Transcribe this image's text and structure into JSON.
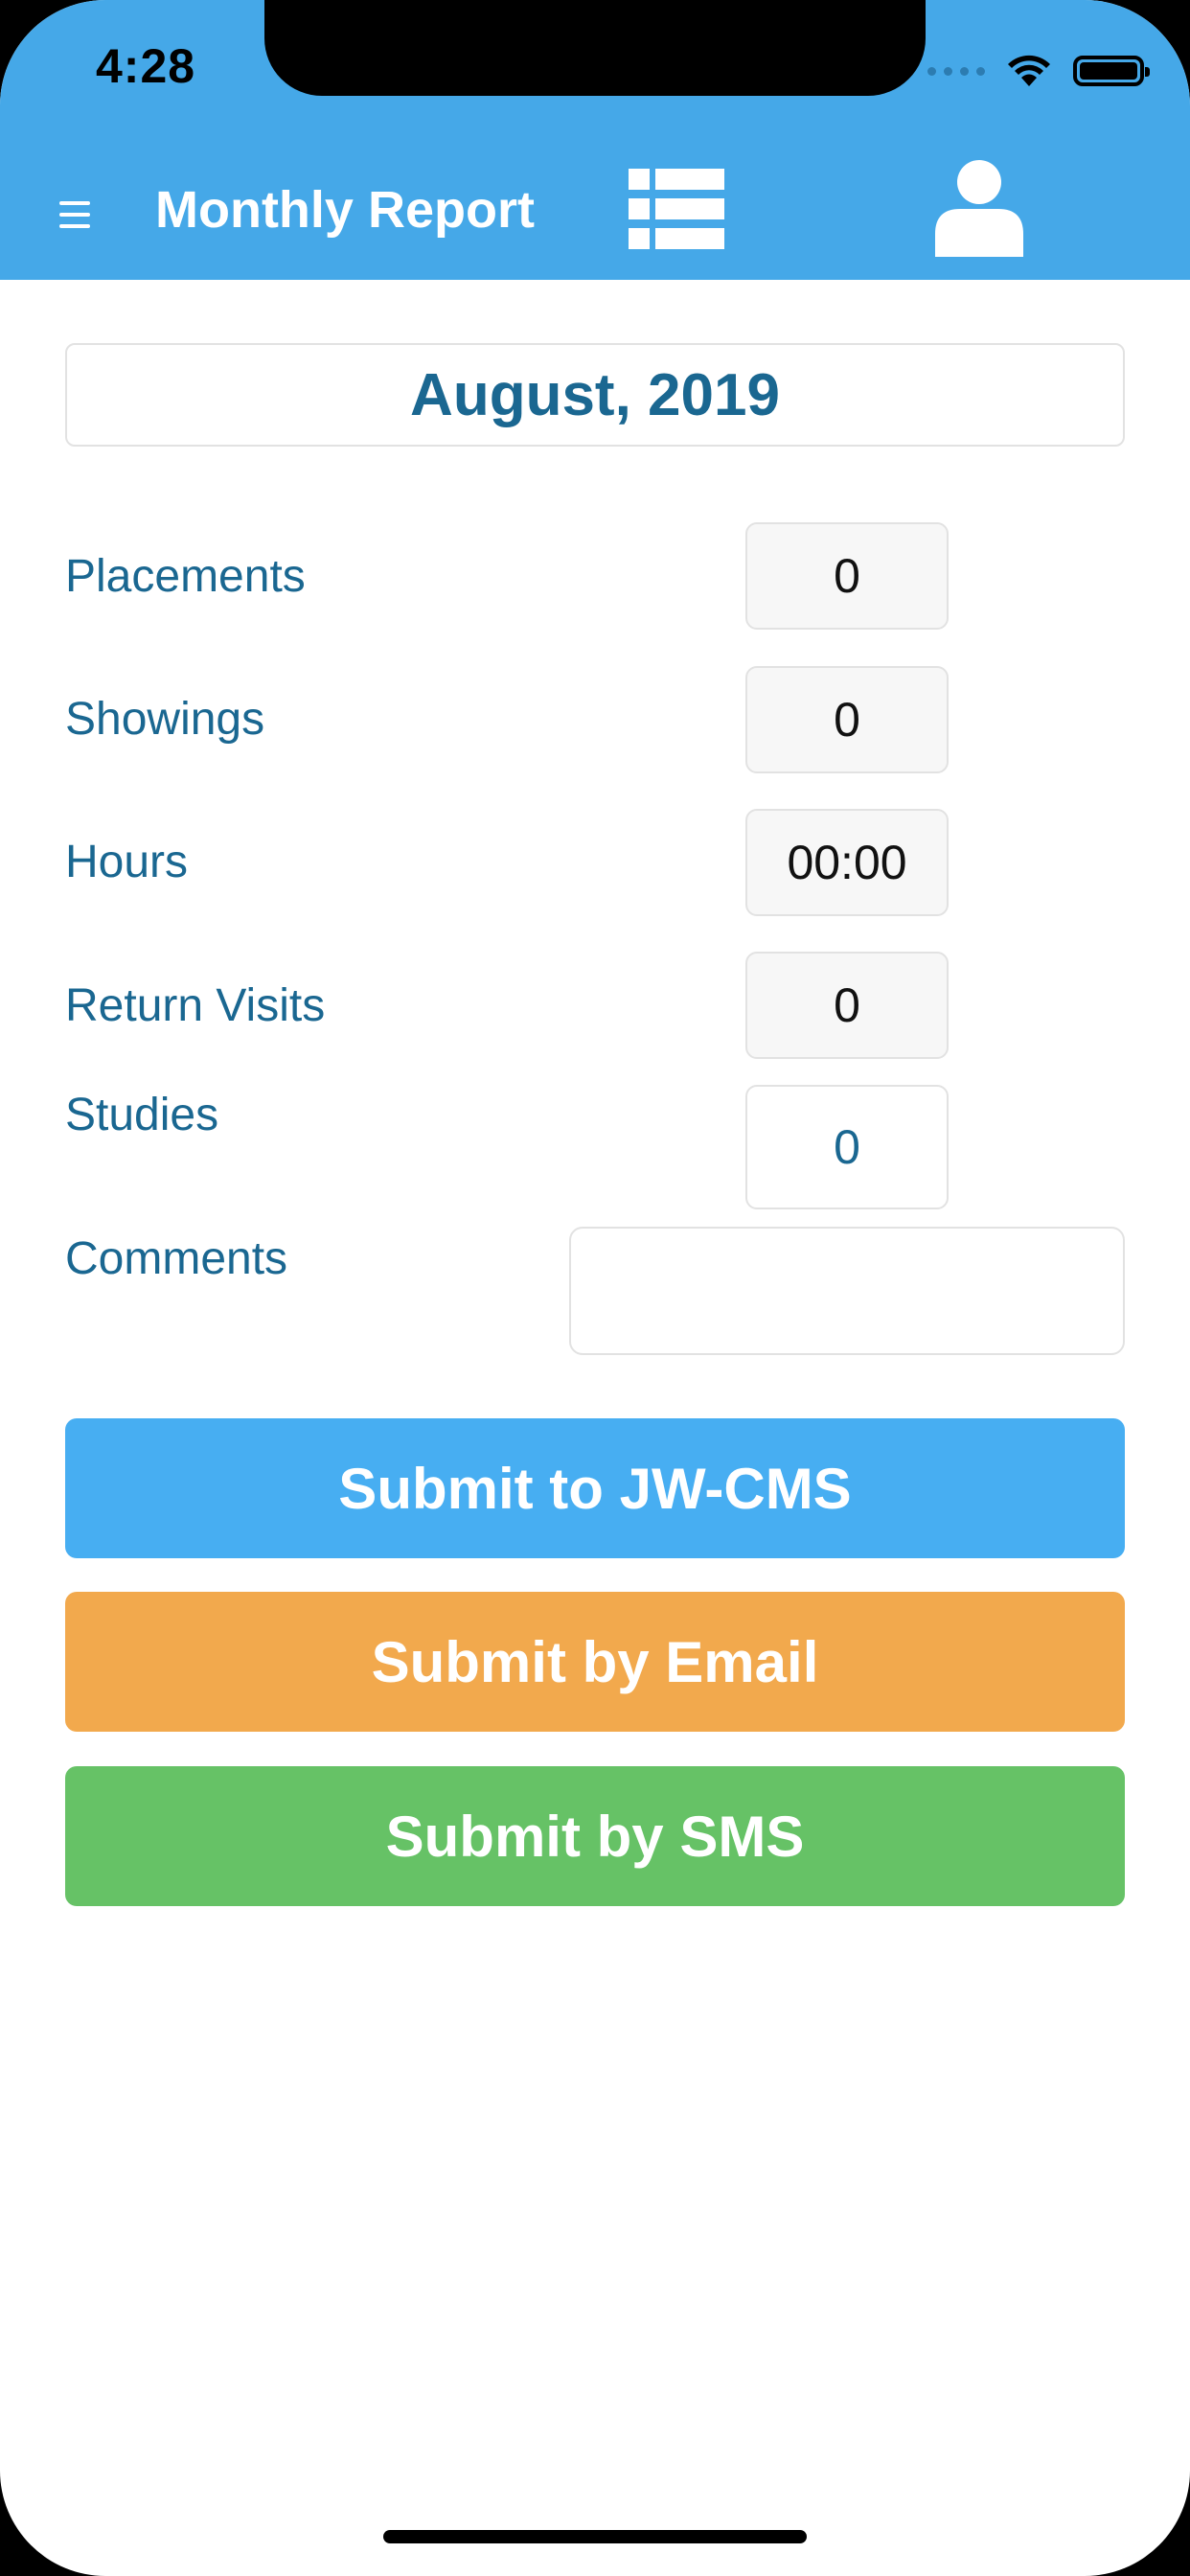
{
  "status_bar": {
    "time": "4:28",
    "wifi_icon": "wifi-icon",
    "battery_icon": "battery-icon"
  },
  "nav": {
    "menu_icon": "hamburger-menu-icon",
    "title": "Monthly Report",
    "list_icon": "list-view-icon",
    "profile_icon": "user-profile-icon"
  },
  "report": {
    "month": "August, 2019",
    "fields": [
      {
        "label": "Placements",
        "value": "0"
      },
      {
        "label": "Showings",
        "value": "0"
      },
      {
        "label": "Hours",
        "value": "00:00"
      },
      {
        "label": "Return Visits",
        "value": "0"
      },
      {
        "label": "Studies",
        "value": "0"
      }
    ],
    "comments_label": "Comments",
    "comments_value": ""
  },
  "buttons": {
    "jw_cms": "Submit to JW-CMS",
    "email": "Submit by Email",
    "sms": "Submit by SMS"
  },
  "colors": {
    "header": "#45a8e8",
    "label": "#1a6791",
    "btn_jw": "#47aef2",
    "btn_email": "#f2a94d",
    "btn_sms": "#66c266"
  }
}
